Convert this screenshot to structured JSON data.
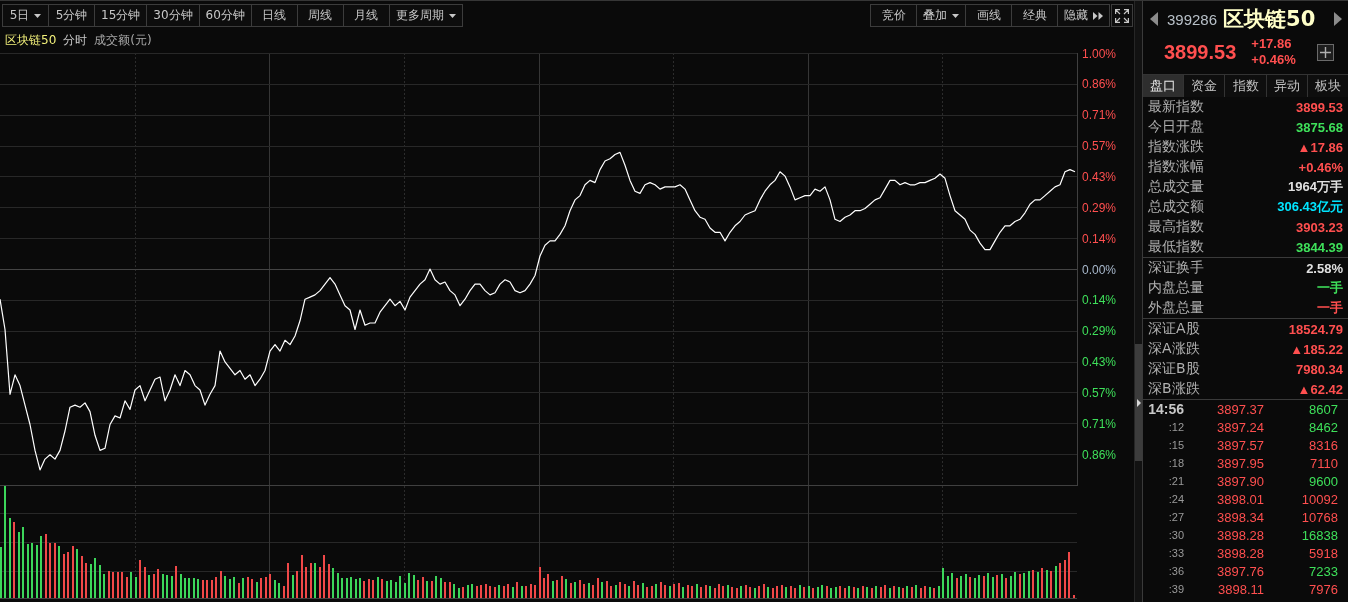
{
  "toolbar": {
    "periods": [
      {
        "label": "5日",
        "kind": "dropdown"
      },
      {
        "label": "5分钟",
        "kind": "plain"
      },
      {
        "label": "15分钟",
        "kind": "plain"
      },
      {
        "label": "30分钟",
        "kind": "plain"
      },
      {
        "label": "60分钟",
        "kind": "plain"
      },
      {
        "label": "日线",
        "kind": "plain"
      },
      {
        "label": "周线",
        "kind": "plain"
      },
      {
        "label": "月线",
        "kind": "plain"
      },
      {
        "label": "更多周期",
        "kind": "dropdown"
      }
    ],
    "tools": [
      {
        "label": "竞价",
        "kind": "plain"
      },
      {
        "label": "叠加",
        "kind": "dropdown"
      },
      {
        "label": "画线",
        "kind": "plain"
      },
      {
        "label": "经典",
        "kind": "plain"
      },
      {
        "label": "隐藏",
        "kind": "collapse"
      },
      {
        "kind": "fullscreen"
      }
    ]
  },
  "chart_header": {
    "title": "区块链50",
    "mode": "分时",
    "indicator": "成交额(元)"
  },
  "price_chart": {
    "chart_data": {
      "type": "line",
      "grid": true,
      "ylim": [
        -1,
        1
      ],
      "yticks": [
        {
          "value": 1,
          "label": "1.00%"
        },
        {
          "value": 0.857,
          "label": "0.86%"
        },
        {
          "value": 0.714,
          "label": "0.71%"
        },
        {
          "value": 0.571,
          "label": "0.57%"
        },
        {
          "value": 0.429,
          "label": "0.43%"
        },
        {
          "value": 0.286,
          "label": "0.29%"
        },
        {
          "value": 0.143,
          "label": "0.14%"
        },
        {
          "value": 0,
          "label": "0.00%"
        },
        {
          "value": -0.143,
          "label": "0.14%"
        },
        {
          "value": -0.286,
          "label": "0.29%"
        },
        {
          "value": -0.429,
          "label": "0.43%"
        },
        {
          "value": -0.571,
          "label": "0.57%"
        },
        {
          "value": -0.714,
          "label": "0.71%"
        },
        {
          "value": -0.857,
          "label": "0.86%"
        }
      ],
      "series": [
        {
          "color": "#ffffff",
          "values": [
            -0.14,
            -0.28,
            -0.58,
            -0.49,
            -0.54,
            -0.63,
            -0.72,
            -0.84,
            -0.93,
            -0.88,
            -0.86,
            -0.88,
            -0.84,
            -0.75,
            -0.64,
            -0.63,
            -0.64,
            -0.62,
            -0.66,
            -0.77,
            -0.84,
            -0.83,
            -0.72,
            -0.68,
            -0.69,
            -0.61,
            -0.65,
            -0.56,
            -0.54,
            -0.61,
            -0.56,
            -0.51,
            -0.5,
            -0.61,
            -0.56,
            -0.49,
            -0.54,
            -0.47,
            -0.49,
            -0.54,
            -0.56,
            -0.63,
            -0.58,
            -0.54,
            -0.38,
            -0.43,
            -0.46,
            -0.49,
            -0.47,
            -0.51,
            -0.49,
            -0.54,
            -0.51,
            -0.47,
            -0.38,
            -0.35,
            -0.38,
            -0.33,
            -0.35,
            -0.31,
            -0.24,
            -0.14,
            -0.13,
            -0.12,
            -0.1,
            -0.07,
            -0.04,
            -0.07,
            -0.12,
            -0.17,
            -0.19,
            -0.28,
            -0.19,
            -0.26,
            -0.25,
            -0.25,
            -0.2,
            -0.17,
            -0.14,
            -0.17,
            -0.15,
            -0.19,
            -0.13,
            -0.1,
            -0.07,
            -0.05,
            0,
            -0.05,
            -0.07,
            -0.06,
            -0.1,
            -0.12,
            -0.17,
            -0.14,
            -0.1,
            -0.07,
            -0.07,
            -0.1,
            -0.12,
            -0.11,
            -0.07,
            -0.05,
            -0.06,
            -0.1,
            -0.11,
            -0.1,
            -0.07,
            -0.03,
            0.06,
            0.11,
            0.13,
            0.13,
            0.16,
            0.2,
            0.27,
            0.32,
            0.34,
            0.39,
            0.41,
            0.4,
            0.46,
            0.5,
            0.51,
            0.53,
            0.54,
            0.48,
            0.41,
            0.36,
            0.35,
            0.39,
            0.4,
            0.39,
            0.37,
            0.38,
            0.38,
            0.38,
            0.39,
            0.37,
            0.32,
            0.27,
            0.24,
            0.23,
            0.19,
            0.17,
            0.17,
            0.13,
            0.17,
            0.2,
            0.22,
            0.25,
            0.26,
            0.27,
            0.32,
            0.36,
            0.39,
            0.41,
            0.45,
            0.43,
            0.38,
            0.32,
            0.33,
            0.34,
            0.34,
            0.37,
            0.36,
            0.38,
            0.32,
            0.23,
            0.22,
            0.24,
            0.25,
            0.27,
            0.27,
            0.28,
            0.3,
            0.32,
            0.33,
            0.37,
            0.41,
            0.41,
            0.39,
            0.4,
            0.39,
            0.39,
            0.4,
            0.4,
            0.41,
            0.42,
            0.44,
            0.42,
            0.34,
            0.27,
            0.25,
            0.23,
            0.18,
            0.16,
            0.12,
            0.09,
            0.09,
            0.13,
            0.17,
            0.2,
            0.2,
            0.22,
            0.23,
            0.26,
            0.3,
            0.32,
            0.32,
            0.34,
            0.36,
            0.38,
            0.39,
            0.45,
            0.46,
            0.45
          ]
        }
      ]
    }
  },
  "quote": {
    "code": "399286",
    "name": "区块链50",
    "price": "3899.53",
    "change": "+17.86",
    "change_pct": "+0.46%"
  },
  "tabs": [
    {
      "label": "盘口",
      "selected": true
    },
    {
      "label": "资金",
      "selected": false
    },
    {
      "label": "指数",
      "selected": false
    },
    {
      "label": "异动",
      "selected": false
    },
    {
      "label": "板块",
      "selected": false
    }
  ],
  "stat_groups": [
    {
      "rows": [
        {
          "label": "最新指数",
          "value": "3899.53",
          "color": "#ff4f4f"
        },
        {
          "label": "今日开盘",
          "value": "3875.68",
          "color": "#3ee05a"
        },
        {
          "label": "指数涨跌",
          "value": "▲17.86",
          "color": "#ff4f4f"
        },
        {
          "label": "指数涨幅",
          "value": "+0.46%",
          "color": "#ff4f4f"
        },
        {
          "label": "总成交量",
          "value": "1964万手",
          "color": "#e0e0e0"
        },
        {
          "label": "总成交额",
          "value": "306.43亿元",
          "color": "#00e5ff"
        },
        {
          "label": "最高指数",
          "value": "3903.23",
          "color": "#ff4f4f"
        },
        {
          "label": "最低指数",
          "value": "3844.39",
          "color": "#3ee05a"
        }
      ]
    },
    {
      "rows": [
        {
          "label": "深证换手",
          "value": "2.58%",
          "color": "#e0e0e0"
        },
        {
          "label": "内盘总量",
          "value": "一手",
          "color": "#3ee05a"
        },
        {
          "label": "外盘总量",
          "value": "一手",
          "color": "#ff4f4f"
        }
      ]
    },
    {
      "rows": [
        {
          "label": "深证A股",
          "value": "18524.79",
          "color": "#ff4f4f"
        },
        {
          "label": "深A涨跌",
          "value": "▲185.22",
          "color": "#ff4f4f"
        },
        {
          "label": "深证B股",
          "value": "7980.34",
          "color": "#ff4f4f"
        },
        {
          "label": "深B涨跌",
          "value": "▲62.42",
          "color": "#ff4f4f"
        }
      ]
    }
  ],
  "ticks": [
    {
      "time": "14:56",
      "price": "3897.37",
      "volume": "8607",
      "color": "#3ee05a"
    },
    {
      "time": ":12",
      "price": "3897.24",
      "volume": "8462",
      "color": "#3ee05a"
    },
    {
      "time": ":15",
      "price": "3897.57",
      "volume": "8316",
      "color": "#ff4f4f"
    },
    {
      "time": ":18",
      "price": "3897.95",
      "volume": "7110",
      "color": "#ff4f4f"
    },
    {
      "time": ":21",
      "price": "3897.90",
      "volume": "9600",
      "color": "#3ee05a"
    },
    {
      "time": ":24",
      "price": "3898.01",
      "volume": "10092",
      "color": "#ff4f4f"
    },
    {
      "time": ":27",
      "price": "3898.34",
      "volume": "10768",
      "color": "#ff4f4f"
    },
    {
      "time": ":30",
      "price": "3898.28",
      "volume": "16838",
      "color": "#3ee05a"
    },
    {
      "time": ":33",
      "price": "3898.28",
      "volume": "5918",
      "color": "#ff4f4f"
    },
    {
      "time": ":36",
      "price": "3897.76",
      "volume": "7233",
      "color": "#3ee05a"
    },
    {
      "time": ":39",
      "price": "3898.11",
      "volume": "7976",
      "color": "#ff4f4f"
    }
  ]
}
